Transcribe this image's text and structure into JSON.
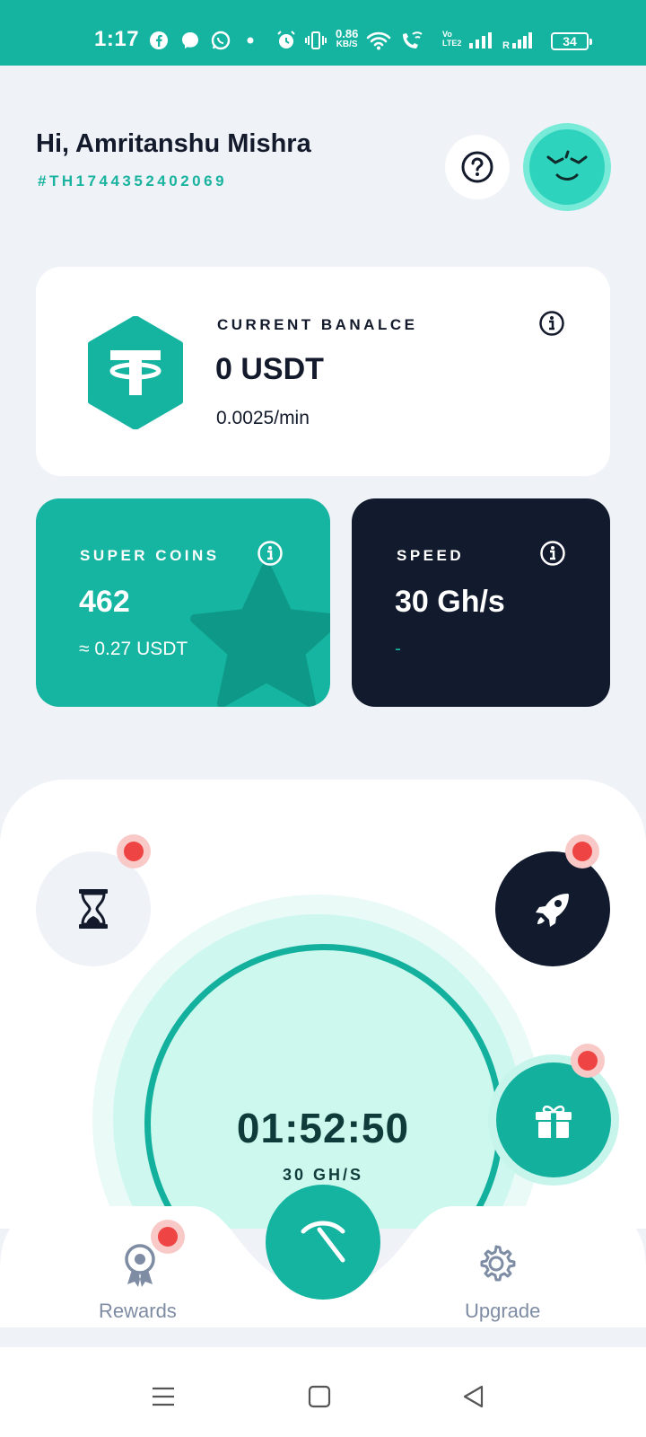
{
  "status_bar": {
    "time": "1:17",
    "net_speed_value": "0.86",
    "net_speed_unit": "KB/S",
    "volte_line1": "Vo",
    "volte_line2": "LTE2",
    "battery": "34",
    "icons": [
      "facebook-icon",
      "messenger-icon",
      "whatsapp-icon",
      "dot-icon",
      "alarm-icon",
      "vibrate-icon",
      "wifi-icon",
      "wifi-call-icon",
      "signal-icon",
      "signal-roaming-icon",
      "battery-icon"
    ]
  },
  "header": {
    "greeting": "Hi, Amritanshu Mishra",
    "user_id": "#TH1744352402069"
  },
  "balance": {
    "label": "CURRENT BANALCE",
    "value": "0 USDT",
    "rate": "0.0025/min"
  },
  "super_coins": {
    "label": "SUPER COINS",
    "value": "462",
    "sub": "≈ 0.27 USDT"
  },
  "speed": {
    "label": "SPEED",
    "value": "30 Gh/s",
    "sub": "-"
  },
  "mining": {
    "timer": "01:52:50",
    "speed_label": "30 GH/S"
  },
  "nav": {
    "rewards_label": "Rewards",
    "upgrade_label": "Upgrade"
  },
  "colors": {
    "brand": "#14b4a1",
    "dark": "#121a2d",
    "background": "#eff2f7",
    "notification": "#ee4444"
  }
}
